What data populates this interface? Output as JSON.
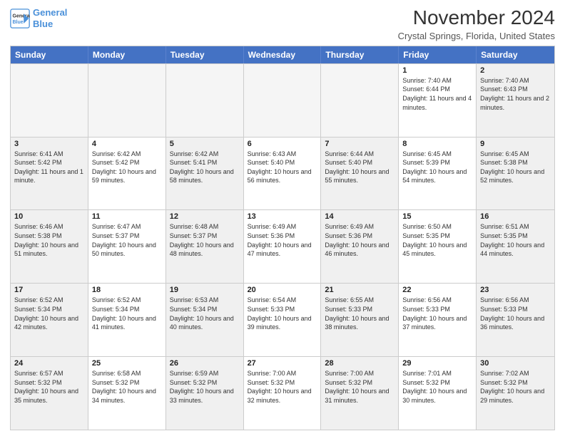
{
  "header": {
    "logo_line1": "General",
    "logo_line2": "Blue",
    "month_title": "November 2024",
    "location": "Crystal Springs, Florida, United States"
  },
  "weekdays": [
    "Sunday",
    "Monday",
    "Tuesday",
    "Wednesday",
    "Thursday",
    "Friday",
    "Saturday"
  ],
  "weeks": [
    [
      {
        "day": "",
        "info": "",
        "empty": true
      },
      {
        "day": "",
        "info": "",
        "empty": true
      },
      {
        "day": "",
        "info": "",
        "empty": true
      },
      {
        "day": "",
        "info": "",
        "empty": true
      },
      {
        "day": "",
        "info": "",
        "empty": true
      },
      {
        "day": "1",
        "info": "Sunrise: 7:40 AM\nSunset: 6:44 PM\nDaylight: 11 hours and 4 minutes.",
        "empty": false
      },
      {
        "day": "2",
        "info": "Sunrise: 7:40 AM\nSunset: 6:43 PM\nDaylight: 11 hours and 2 minutes.",
        "empty": false
      }
    ],
    [
      {
        "day": "3",
        "info": "Sunrise: 6:41 AM\nSunset: 5:42 PM\nDaylight: 11 hours and 1 minute.",
        "empty": false
      },
      {
        "day": "4",
        "info": "Sunrise: 6:42 AM\nSunset: 5:42 PM\nDaylight: 10 hours and 59 minutes.",
        "empty": false
      },
      {
        "day": "5",
        "info": "Sunrise: 6:42 AM\nSunset: 5:41 PM\nDaylight: 10 hours and 58 minutes.",
        "empty": false
      },
      {
        "day": "6",
        "info": "Sunrise: 6:43 AM\nSunset: 5:40 PM\nDaylight: 10 hours and 56 minutes.",
        "empty": false
      },
      {
        "day": "7",
        "info": "Sunrise: 6:44 AM\nSunset: 5:40 PM\nDaylight: 10 hours and 55 minutes.",
        "empty": false
      },
      {
        "day": "8",
        "info": "Sunrise: 6:45 AM\nSunset: 5:39 PM\nDaylight: 10 hours and 54 minutes.",
        "empty": false
      },
      {
        "day": "9",
        "info": "Sunrise: 6:45 AM\nSunset: 5:38 PM\nDaylight: 10 hours and 52 minutes.",
        "empty": false
      }
    ],
    [
      {
        "day": "10",
        "info": "Sunrise: 6:46 AM\nSunset: 5:38 PM\nDaylight: 10 hours and 51 minutes.",
        "empty": false
      },
      {
        "day": "11",
        "info": "Sunrise: 6:47 AM\nSunset: 5:37 PM\nDaylight: 10 hours and 50 minutes.",
        "empty": false
      },
      {
        "day": "12",
        "info": "Sunrise: 6:48 AM\nSunset: 5:37 PM\nDaylight: 10 hours and 48 minutes.",
        "empty": false
      },
      {
        "day": "13",
        "info": "Sunrise: 6:49 AM\nSunset: 5:36 PM\nDaylight: 10 hours and 47 minutes.",
        "empty": false
      },
      {
        "day": "14",
        "info": "Sunrise: 6:49 AM\nSunset: 5:36 PM\nDaylight: 10 hours and 46 minutes.",
        "empty": false
      },
      {
        "day": "15",
        "info": "Sunrise: 6:50 AM\nSunset: 5:35 PM\nDaylight: 10 hours and 45 minutes.",
        "empty": false
      },
      {
        "day": "16",
        "info": "Sunrise: 6:51 AM\nSunset: 5:35 PM\nDaylight: 10 hours and 44 minutes.",
        "empty": false
      }
    ],
    [
      {
        "day": "17",
        "info": "Sunrise: 6:52 AM\nSunset: 5:34 PM\nDaylight: 10 hours and 42 minutes.",
        "empty": false
      },
      {
        "day": "18",
        "info": "Sunrise: 6:52 AM\nSunset: 5:34 PM\nDaylight: 10 hours and 41 minutes.",
        "empty": false
      },
      {
        "day": "19",
        "info": "Sunrise: 6:53 AM\nSunset: 5:34 PM\nDaylight: 10 hours and 40 minutes.",
        "empty": false
      },
      {
        "day": "20",
        "info": "Sunrise: 6:54 AM\nSunset: 5:33 PM\nDaylight: 10 hours and 39 minutes.",
        "empty": false
      },
      {
        "day": "21",
        "info": "Sunrise: 6:55 AM\nSunset: 5:33 PM\nDaylight: 10 hours and 38 minutes.",
        "empty": false
      },
      {
        "day": "22",
        "info": "Sunrise: 6:56 AM\nSunset: 5:33 PM\nDaylight: 10 hours and 37 minutes.",
        "empty": false
      },
      {
        "day": "23",
        "info": "Sunrise: 6:56 AM\nSunset: 5:33 PM\nDaylight: 10 hours and 36 minutes.",
        "empty": false
      }
    ],
    [
      {
        "day": "24",
        "info": "Sunrise: 6:57 AM\nSunset: 5:32 PM\nDaylight: 10 hours and 35 minutes.",
        "empty": false
      },
      {
        "day": "25",
        "info": "Sunrise: 6:58 AM\nSunset: 5:32 PM\nDaylight: 10 hours and 34 minutes.",
        "empty": false
      },
      {
        "day": "26",
        "info": "Sunrise: 6:59 AM\nSunset: 5:32 PM\nDaylight: 10 hours and 33 minutes.",
        "empty": false
      },
      {
        "day": "27",
        "info": "Sunrise: 7:00 AM\nSunset: 5:32 PM\nDaylight: 10 hours and 32 minutes.",
        "empty": false
      },
      {
        "day": "28",
        "info": "Sunrise: 7:00 AM\nSunset: 5:32 PM\nDaylight: 10 hours and 31 minutes.",
        "empty": false
      },
      {
        "day": "29",
        "info": "Sunrise: 7:01 AM\nSunset: 5:32 PM\nDaylight: 10 hours and 30 minutes.",
        "empty": false
      },
      {
        "day": "30",
        "info": "Sunrise: 7:02 AM\nSunset: 5:32 PM\nDaylight: 10 hours and 29 minutes.",
        "empty": false
      }
    ]
  ]
}
